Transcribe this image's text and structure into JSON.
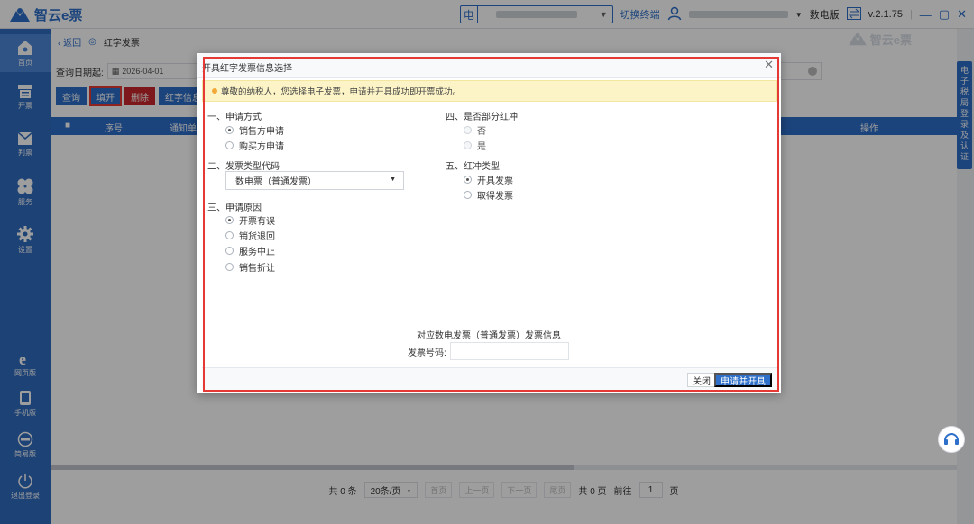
{
  "app": {
    "name": "智云e票",
    "tax_tag": "电",
    "switch_terminal": "切换终端",
    "edition": "数电版",
    "version": "v.2.1.75",
    "win_controls": [
      "—",
      "▢",
      "✕"
    ]
  },
  "sidebar": {
    "items": [
      {
        "label": "首页",
        "icon": "home-icon"
      },
      {
        "label": "开票",
        "icon": "printer-icon"
      },
      {
        "label": "判票",
        "icon": "envelope-icon"
      },
      {
        "label": "服务",
        "icon": "clover-icon"
      },
      {
        "label": "设置",
        "icon": "gear-icon"
      },
      {
        "label": "网页版",
        "icon": "browser-icon"
      },
      {
        "label": "手机版",
        "icon": "phone-icon"
      },
      {
        "label": "简易版",
        "icon": "lite-icon"
      },
      {
        "label": "退出登录",
        "icon": "power-icon"
      }
    ]
  },
  "page": {
    "back": "返回",
    "title": "红字发票",
    "watermark": "智云e票",
    "date_label": "查询日期起:",
    "date_value": "2026-04-01",
    "buttons": {
      "query": "查询",
      "fill": "填开",
      "delete": "删除",
      "red_info": "红字信息"
    },
    "columns": {
      "no": "序号",
      "notice": "通知单",
      "ops": "操作"
    },
    "pager": {
      "total": "共 0 条",
      "page_size": "20条/页",
      "first": "首页",
      "prev": "上一页",
      "next": "下一页",
      "last": "尾页",
      "pages": "共 0 页",
      "goto": "前往",
      "page": "1",
      "page_unit": "页"
    }
  },
  "right_tab": {
    "text": [
      "电",
      "子",
      "税",
      "局",
      "登",
      "录",
      "及",
      "认",
      "证"
    ]
  },
  "dialog": {
    "title": "开具红字发票信息选择",
    "notice": "尊敬的纳税人，您选择电子发票，申请并开具成功即开票成功。",
    "sections": {
      "apply_method": "一、申请方式",
      "ticket_type": "二、发票类型代码",
      "reason": "三、申请原因",
      "partial": "四、是否部分红冲",
      "red_type": "五、红冲类型"
    },
    "apply_options": [
      "销售方申请",
      "购买方申请"
    ],
    "apply_selected": 0,
    "ticket_type_value": "数电票（普通发票）",
    "reason_options": [
      "开票有误",
      "销货退回",
      "服务中止",
      "销售折让"
    ],
    "reason_selected": 0,
    "partial_options": [
      "否",
      "是"
    ],
    "red_type_options": [
      "开具发票",
      "取得发票"
    ],
    "red_type_selected": 0,
    "sub_info": "对应数电发票（普通发票）发票信息",
    "invoice_no_label": "发票号码:",
    "invoice_no_value": "",
    "close_btn": "关闭",
    "apply_btn": "申请并开具"
  }
}
